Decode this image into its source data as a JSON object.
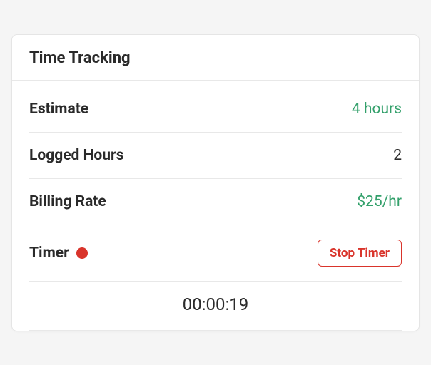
{
  "card": {
    "title": "Time Tracking"
  },
  "rows": {
    "estimate": {
      "label": "Estimate",
      "value": "4 hours"
    },
    "logged": {
      "label": "Logged Hours",
      "value": "2"
    },
    "rate": {
      "label": "Billing Rate",
      "value": "$25/hr"
    },
    "timer": {
      "label": "Timer",
      "button": "Stop Timer"
    }
  },
  "timer_display": "00:00:19",
  "colors": {
    "accent_green": "#33a06b",
    "accent_red": "#d9342b"
  }
}
